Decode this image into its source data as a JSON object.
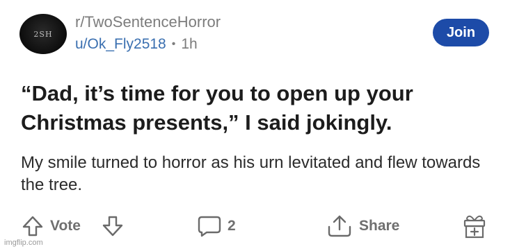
{
  "header": {
    "avatar_text": "2SH",
    "subreddit": "r/TwoSentenceHorror",
    "username": "u/Ok_Fly2518",
    "separator": "•",
    "time": "1h",
    "join_label": "Join"
  },
  "post": {
    "title": "“Dad, it’s time for you to open up your Christmas presents,” I said jokingly.",
    "body": "My smile turned to horror as his urn levitated and flew towards the tree."
  },
  "actions": {
    "vote_label": "Vote",
    "comment_count": "2",
    "share_label": "Share"
  },
  "icons": {
    "upvote": "arrow-up-icon",
    "downvote": "arrow-down-icon",
    "comment": "comment-bubble-icon",
    "share": "share-icon",
    "award": "gift-icon"
  },
  "watermark": "imgflip.com",
  "colors": {
    "join_bg": "#1d4ba8",
    "username": "#3a6fb0",
    "muted": "#7c7c7c",
    "text": "#1c1c1c"
  }
}
